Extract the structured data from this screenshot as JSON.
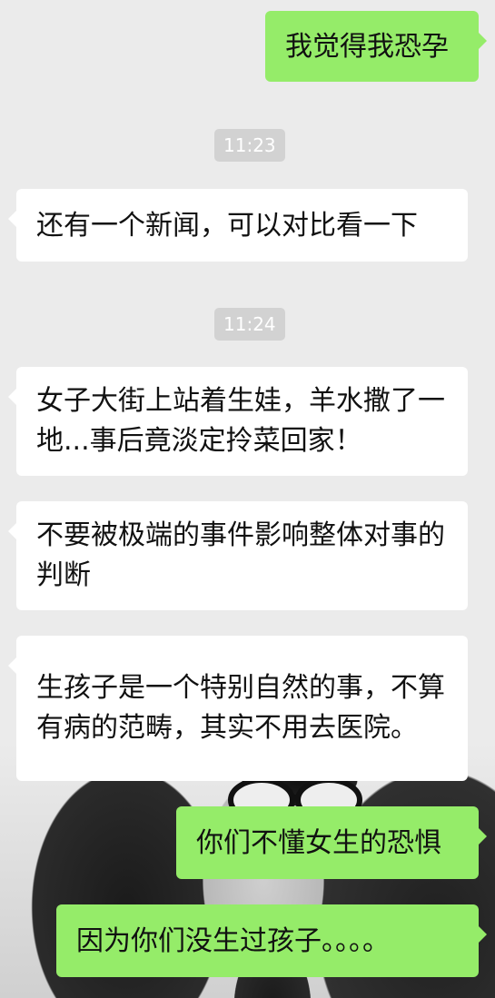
{
  "chat": {
    "messages": [
      {
        "side": "out",
        "text": "我觉得我恐孕"
      },
      {
        "side": "time",
        "text": "11:23"
      },
      {
        "side": "in",
        "text": "还有一个新闻，可以对比看一下"
      },
      {
        "side": "time",
        "text": "11:24"
      },
      {
        "side": "in",
        "text": "女子大街上站着生娃，羊水撒了一地...事后竟淡定拎菜回家！"
      },
      {
        "side": "in",
        "text": "不要被极端的事件影响整体对事的判断"
      },
      {
        "side": "in",
        "text": "生孩子是一个特别自然的事，不算有病的范畴，其实不用去医院。"
      },
      {
        "side": "out",
        "text": "你们不懂女生的恐惧"
      },
      {
        "side": "out",
        "text": "因为你们没生过孩子。。。。"
      }
    ]
  },
  "colors": {
    "background": "#ebebeb",
    "incoming_bubble": "#ffffff",
    "outgoing_bubble": "#95ec69",
    "time_badge": "#d2d2d2"
  }
}
